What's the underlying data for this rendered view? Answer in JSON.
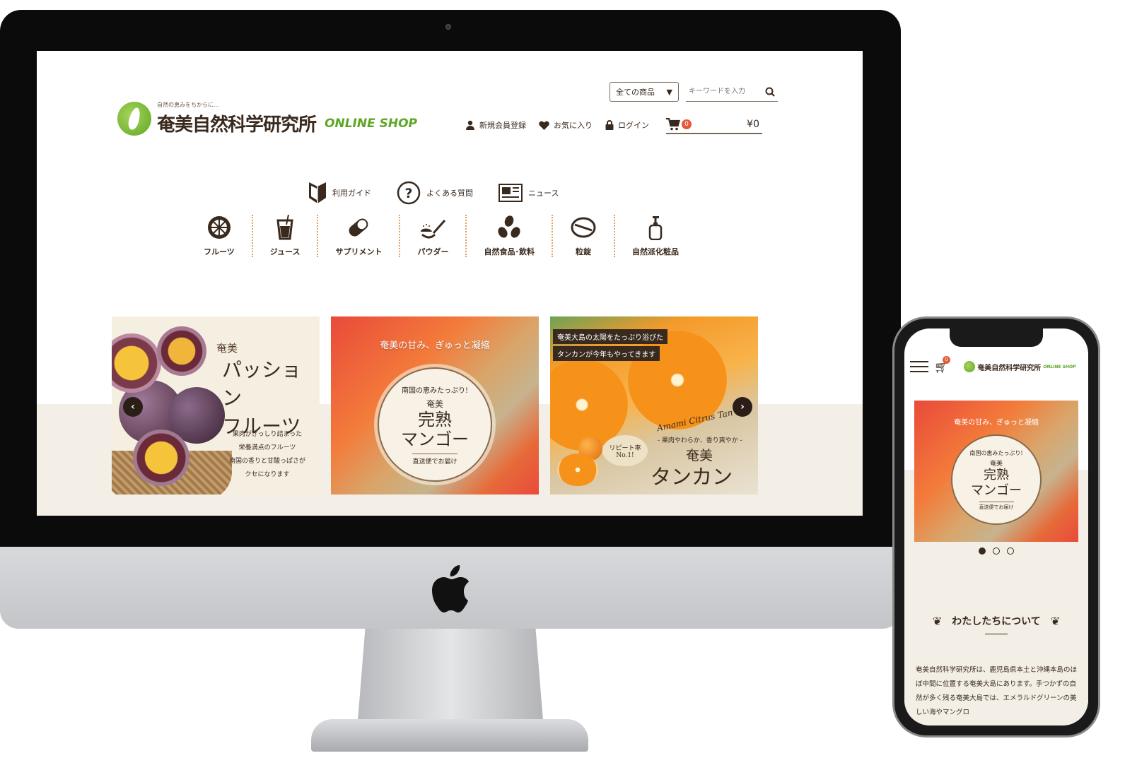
{
  "desktop": {
    "logo": {
      "tagline": "自然の恵みをちからに…",
      "name": "奄美自然科学研究所",
      "shop": "ONLINE SHOP"
    },
    "search": {
      "category_select": "全ての商品",
      "placeholder": "キーワードを入力"
    },
    "util_nav": [
      {
        "label": "新規会員登録",
        "icon": "user-icon"
      },
      {
        "label": "お気に入り",
        "icon": "heart-icon"
      },
      {
        "label": "ログイン",
        "icon": "lock-icon"
      }
    ],
    "cart": {
      "count": "0",
      "total": "¥0"
    },
    "guide_nav": [
      {
        "label": "利用ガイド",
        "icon": "beginner-mark-icon"
      },
      {
        "label": "よくある質問",
        "icon": "question-icon"
      },
      {
        "label": "ニュース",
        "icon": "newspaper-icon"
      }
    ],
    "categories": [
      {
        "label": "フルーツ",
        "icon": "citrus-slice-icon"
      },
      {
        "label": "ジュース",
        "icon": "cup-icon"
      },
      {
        "label": "サプリメント",
        "icon": "capsule-icon"
      },
      {
        "label": "パウダー",
        "icon": "powder-spoon-icon"
      },
      {
        "label": "自然食品･飲料",
        "icon": "beans-icon"
      },
      {
        "label": "粒錠",
        "icon": "tablet-icon"
      },
      {
        "label": "自然派化粧品",
        "icon": "pump-bottle-icon"
      }
    ],
    "banners": {
      "passion": {
        "kicker": "奄美",
        "title_line1": "パッション",
        "title_line2": "フルーツ",
        "copy": [
          "果肉がぎっしり詰まった",
          "栄養満点のフルーツ",
          "南国の香りと甘酸っぱさが",
          "クセになります"
        ]
      },
      "mango": {
        "top": "奄美の甘み、ぎゅっと凝縮",
        "arc": "南国の恵みたっぷり!",
        "kicker": "奄美",
        "title_line1": "完熟",
        "title_line2": "マンゴー",
        "foot": "直送便でお届け"
      },
      "tankan": {
        "tag1": "奄美大島の太陽をたっぷり浴びた",
        "tag2": "タンカンが今年もやってきます",
        "bubble_line1": "リピート率",
        "bubble_line2": "No.1!",
        "script": "Amami Citrus Tan",
        "copy": "- 果肉やわらか、香り爽やか -",
        "kicker": "奄美",
        "title": "タンカン"
      }
    }
  },
  "mobile": {
    "cart_count": "0",
    "logo": {
      "name": "奄美自然科学研究所",
      "shop": "ONLINE SHOP"
    },
    "banner": {
      "top": "奄美の甘み、ぎゅっと凝縮",
      "arc": "南国の恵みたっぷり!",
      "kicker": "奄美",
      "title_line1": "完熟",
      "title_line2": "マンゴー",
      "foot": "直送便でお届け"
    },
    "slider": {
      "active_index": 1,
      "total": 3
    },
    "about": {
      "title": "わたしたちについて",
      "text": "奄美自然科学研究所は、鹿児島県本土と沖縄本島のほぼ中間に位置する奄美大島にあります。手つかずの自然が多く残る奄美大島では、エメラルドグリーンの美しい海やマングロ"
    }
  },
  "colors": {
    "brand_green": "#5ea726",
    "text_brown": "#3a2a1e",
    "badge_red": "#e45a3a",
    "band_beige": "#f3eee6"
  }
}
